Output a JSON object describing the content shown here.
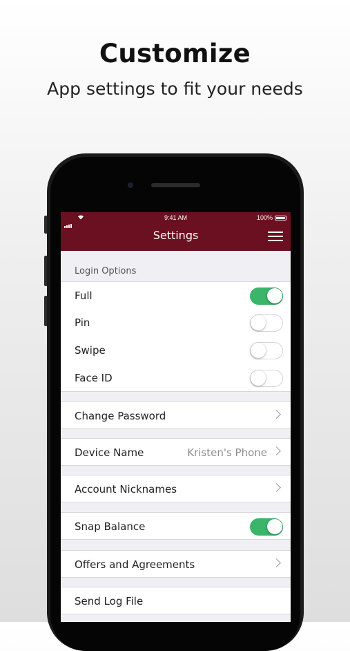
{
  "promo": {
    "headline": "Customize",
    "subline": "App settings to fit your needs"
  },
  "status_bar": {
    "time": "9:41 AM",
    "battery": "100%"
  },
  "nav": {
    "title": "Settings",
    "menu_icon": "hamburger-menu-icon",
    "bar_color": "#6b1020"
  },
  "login_options": {
    "header": "Login Options",
    "items": [
      {
        "label": "Full",
        "enabled": true
      },
      {
        "label": "Pin",
        "enabled": false
      },
      {
        "label": "Swipe",
        "enabled": false
      },
      {
        "label": "Face ID",
        "enabled": false
      }
    ]
  },
  "settings": {
    "change_password": "Change Password",
    "device_name_label": "Device Name",
    "device_name_value": "Kristen's Phone",
    "account_nicknames": "Account Nicknames",
    "snap_balance": {
      "label": "Snap Balance",
      "enabled": true
    },
    "offers_agreements": "Offers and Agreements",
    "send_log_file": "Send Log File"
  },
  "colors": {
    "toggle_on": "#3ab56a",
    "background": "#efeff4"
  }
}
